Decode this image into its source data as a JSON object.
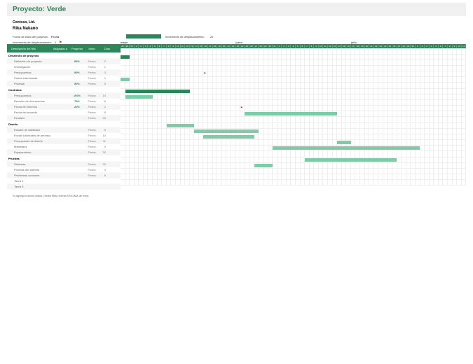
{
  "title": "Proyecto: Verde",
  "company": "Contoso, Ltd.",
  "manager": "Rika Nakano",
  "labels": {
    "startDateLabel": "Fecha de inicio del proyecto:",
    "startDateVal": "Fecha",
    "scrollLabel": "Incremento de desplazamiento:",
    "scrollVal": "1",
    "legendText": "Incremento de desplazamiento:",
    "legendNum": "22"
  },
  "columns": {
    "desc": "Descripción del hito",
    "asig": "Asignado a",
    "prog": "Progreso",
    "ini": "Inicio",
    "dias": "Días"
  },
  "months": [
    "mayo",
    "junio",
    "julio"
  ],
  "days": [
    "28",
    "29",
    "30",
    "1",
    "2",
    "3",
    "4",
    "5",
    "6",
    "7",
    "8",
    "9",
    "10",
    "11",
    "12",
    "13",
    "14",
    "15",
    "16",
    "17",
    "18",
    "19",
    "20",
    "21",
    "22",
    "23",
    "24",
    "25",
    "26",
    "27",
    "28",
    "29",
    "30",
    "31",
    "1",
    "2",
    "3",
    "4",
    "5",
    "6",
    "7",
    "8",
    "9",
    "10",
    "11",
    "12",
    "13",
    "14",
    "15",
    "16",
    "17",
    "18",
    "19",
    "20",
    "21",
    "22",
    "23",
    "24",
    "25",
    "26",
    "27",
    "28",
    "29",
    "30",
    "1",
    "2",
    "3",
    "4",
    "5",
    "6",
    "7",
    "8",
    "9",
    "10",
    "11"
  ],
  "rows": [
    {
      "type": "phase",
      "desc": "Desarrollo de proyecto"
    },
    {
      "type": "task",
      "desc": "Definición de proyecto",
      "prog": "85%",
      "ini": "Fecha",
      "dias": "2",
      "alt": true,
      "bar": {
        "start": 0,
        "len": 2,
        "done": true
      }
    },
    {
      "type": "task",
      "desc": "Investigación",
      "prog": "",
      "ini": "Fecha",
      "dias": "1"
    },
    {
      "type": "task",
      "desc": "Presupuestos",
      "prog": "90%",
      "ini": "Fecha",
      "dias": "3",
      "alt": true
    },
    {
      "type": "task",
      "desc": "Partes interesadas",
      "prog": "",
      "ini": "Fecha",
      "dias": "1",
      "flag": 18
    },
    {
      "type": "task",
      "desc": "Pruebas",
      "prog": "50%",
      "ini": "Fecha",
      "dias": "5",
      "alt": true,
      "bar": {
        "start": 0,
        "len": 2
      }
    },
    {
      "type": "phase",
      "desc": "Contratos"
    },
    {
      "type": "task",
      "desc": "Presupuestos",
      "prog": "100%",
      "ini": "Fecha",
      "dias": "14",
      "alt": true,
      "bar": {
        "start": 1,
        "len": 14,
        "done": true
      }
    },
    {
      "type": "task",
      "desc": "Revisión de documentos",
      "prog": "75%",
      "ini": "Fecha",
      "dias": "6",
      "bar": {
        "start": 1,
        "len": 6
      }
    },
    {
      "type": "task",
      "desc": "Fecha de entrevos",
      "prog": "20%",
      "ini": "Fecha",
      "dias": "2",
      "alt": true
    },
    {
      "type": "task",
      "desc": "Fecha del acuerdo",
      "prog": "",
      "ini": "Fecha",
      "dias": "5",
      "flag": 26
    },
    {
      "type": "task",
      "desc": "Finalizar",
      "prog": "",
      "ini": "Fecha",
      "dias": "20",
      "alt": true,
      "bar": {
        "start": 27,
        "len": 20
      }
    },
    {
      "type": "phase",
      "desc": "Diseño"
    },
    {
      "type": "task",
      "desc": "Estudio de viabilidad",
      "prog": "",
      "ini": "Fecha",
      "dias": "6",
      "alt": true,
      "bar": {
        "start": 10,
        "len": 6
      }
    },
    {
      "type": "task",
      "desc": "Enviar solicitudes de permiso",
      "prog": "",
      "ini": "Fecha",
      "dias": "14",
      "bar": {
        "start": 16,
        "len": 14
      }
    },
    {
      "type": "task",
      "desc": "Presupuesto de diseño",
      "prog": "",
      "ini": "Fecha",
      "dias": "11",
      "alt": true,
      "bar": {
        "start": 18,
        "len": 11
      }
    },
    {
      "type": "task",
      "desc": "Materiales",
      "prog": "",
      "ini": "Fecha",
      "dias": "3",
      "bar": {
        "start": 47,
        "len": 3
      }
    },
    {
      "type": "task",
      "desc": "Equipamiento",
      "prog": "",
      "ini": "Fecha",
      "dias": "32",
      "alt": true,
      "bar": {
        "start": 33,
        "len": 32
      }
    },
    {
      "type": "phase",
      "desc": "Pruebas"
    },
    {
      "type": "task",
      "desc": "Sistemas",
      "prog": "",
      "ini": "Fecha",
      "dias": "20",
      "alt": true,
      "bar": {
        "start": 40,
        "len": 20
      }
    },
    {
      "type": "task",
      "desc": "Pruebas del sistema",
      "prog": "",
      "ini": "Fecha",
      "dias": "4",
      "bar": {
        "start": 29,
        "len": 4
      }
    },
    {
      "type": "task",
      "desc": "Problemas comunes",
      "prog": "",
      "ini": "Fecha",
      "dias": "6",
      "alt": true
    },
    {
      "type": "task",
      "desc": "Tarea 4",
      "prog": "",
      "ini": "",
      "dias": ""
    },
    {
      "type": "task",
      "desc": "Tarea 5",
      "prog": "",
      "ini": "",
      "dias": "",
      "alt": true
    }
  ],
  "footer": "Si agrega nuevos datos, revise filas nuevas ENCIMA de esta.",
  "chart_data": {
    "type": "table",
    "title": "Proyecto: Verde — Gantt",
    "columns": [
      "Descripción del hito",
      "Asignado a",
      "Progreso",
      "Inicio",
      "Días"
    ],
    "data": [
      [
        "Definición de proyecto",
        "",
        "85%",
        "Fecha",
        2
      ],
      [
        "Investigación",
        "",
        "",
        "Fecha",
        1
      ],
      [
        "Presupuestos",
        "",
        "90%",
        "Fecha",
        3
      ],
      [
        "Partes interesadas",
        "",
        "",
        "Fecha",
        1
      ],
      [
        "Pruebas",
        "",
        "50%",
        "Fecha",
        5
      ],
      [
        "Presupuestos",
        "",
        "100%",
        "Fecha",
        14
      ],
      [
        "Revisión de documentos",
        "",
        "75%",
        "Fecha",
        6
      ],
      [
        "Fecha de entrevos",
        "",
        "20%",
        "Fecha",
        2
      ],
      [
        "Fecha del acuerdo",
        "",
        "",
        "Fecha",
        5
      ],
      [
        "Finalizar",
        "",
        "",
        "Fecha",
        20
      ],
      [
        "Estudio de viabilidad",
        "",
        "",
        "Fecha",
        6
      ],
      [
        "Enviar solicitudes de permiso",
        "",
        "",
        "Fecha",
        14
      ],
      [
        "Presupuesto de diseño",
        "",
        "",
        "Fecha",
        11
      ],
      [
        "Materiales",
        "",
        "",
        "Fecha",
        3
      ],
      [
        "Equipamiento",
        "",
        "",
        "Fecha",
        32
      ],
      [
        "Sistemas",
        "",
        "",
        "Fecha",
        20
      ],
      [
        "Pruebas del sistema",
        "",
        "",
        "Fecha",
        4
      ],
      [
        "Problemas comunes",
        "",
        "",
        "Fecha",
        6
      ]
    ]
  }
}
